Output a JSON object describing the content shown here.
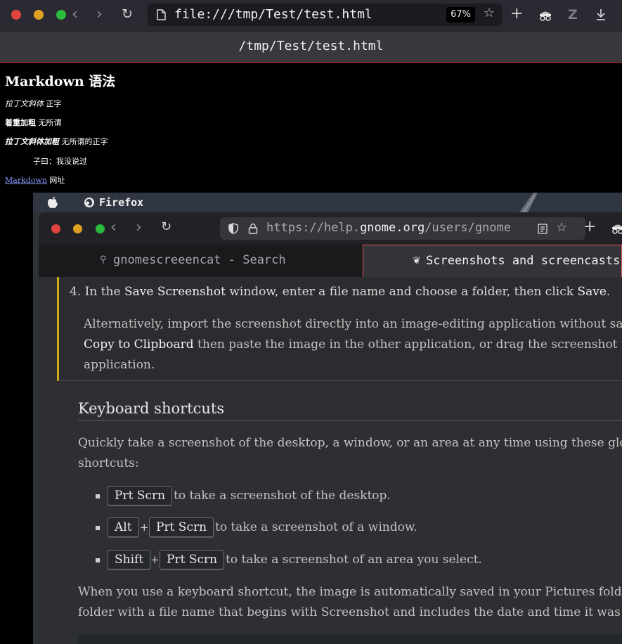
{
  "browser": {
    "url": "file:///tmp/Test/test.html",
    "zoom": "67%",
    "page_title": "/tmp/Test/test.html"
  },
  "content": {
    "heading": "Markdown 语法",
    "line1_italic": "拉丁文斜体",
    "line1_rest": "正字",
    "line2_bold": "着重加粗",
    "line2_rest": "无所谓",
    "line3_bolditalic": "拉丁文斜体加粗",
    "line3_rest": "无所谓的正字",
    "blockquote": "子曰：我没说过",
    "link_text": "Markdown",
    "link_rest": "网址"
  },
  "screenshot": {
    "topbar_app": "Firefox",
    "url_prefix": "https://help.",
    "url_host": "gnome.org",
    "url_suffix": "/users/gnome",
    "tab1": "gnomescreeencat - Search",
    "tab2": "Screenshots and screencasts",
    "step_number": "4.",
    "step_text_1": "In the",
    "step_bold_1": "Save Screenshot",
    "step_text_2": "window, enter a file name and choose a folder, then click",
    "step_bold_2": "Save",
    "step_end": ".",
    "alt_line1": "Alternatively, import the screenshot directly into an image-editing application without saving",
    "alt_bold": "Copy to Clipboard",
    "alt_line2": "then paste the image in the other application, or drag the screenshot thum",
    "alt_line3": "application.",
    "section_heading": "Keyboard shortcuts",
    "intro_line1": "Quickly take a screenshot of the desktop, a window, or an area at any time using these global ke",
    "intro_line2": "shortcuts:",
    "key_prtscrn": "Prt Scrn",
    "key_alt": "Alt",
    "key_shift": "Shift",
    "plus": "+",
    "b1_text": "to take a screenshot of the desktop.",
    "b2_text": "to take a screenshot of a window.",
    "b3_text": "to take a screenshot of an area you select.",
    "final_line1": "When you use a keyboard shortcut, the image is automatically saved in your Pictures folder in y",
    "final_line2": "folder with a file name that begins with Screenshot and includes the date and time it was taken"
  }
}
